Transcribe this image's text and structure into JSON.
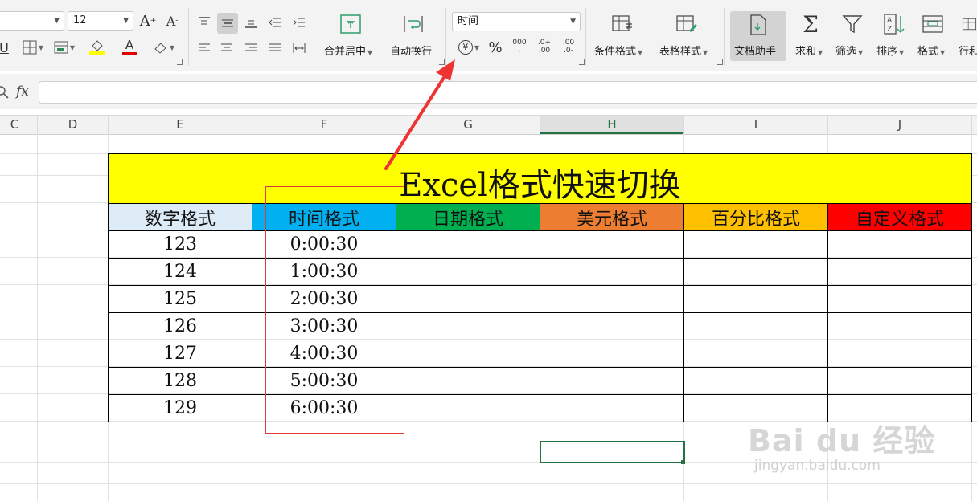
{
  "ribbon": {
    "font_size": "12",
    "align_merge": "合并居中",
    "wrap_text": "自动换行",
    "number_format": "时间",
    "yen_symbol": "¥",
    "percent_symbol": "%",
    "thousands_symbol": "000",
    "dec_inc": ".0+\n.00",
    "dec_dec": ".00\n.0-",
    "conditional_format": "条件格式",
    "table_style": "表格样式",
    "doc_assistant": "文档助手",
    "sum": "求和",
    "filter": "筛选",
    "sort": "排序",
    "format": "格式",
    "row_col": "行和"
  },
  "formula_bar": {
    "fx": "fx",
    "value": ""
  },
  "columns": [
    "C",
    "D",
    "E",
    "F",
    "G",
    "H",
    "I",
    "J"
  ],
  "sheet": {
    "title": "Excel格式快速切换",
    "headers": [
      "数字格式",
      "时间格式",
      "日期格式",
      "美元格式",
      "百分比格式",
      "自定义格式"
    ],
    "header_colors": [
      "#ddebf7",
      "#00b0f0",
      "#00b050",
      "#ed7d31",
      "#ffc000",
      "#ff0000"
    ],
    "title_bg": "#ffff00",
    "rows": [
      [
        "123",
        "0:00:30"
      ],
      [
        "124",
        "1:00:30"
      ],
      [
        "125",
        "2:00:30"
      ],
      [
        "126",
        "3:00:30"
      ],
      [
        "127",
        "4:00:30"
      ],
      [
        "128",
        "5:00:30"
      ],
      [
        "129",
        "6:00:30"
      ]
    ]
  },
  "watermark": {
    "brand": "Bai du 经验",
    "url": "jingyan.baidu.com"
  }
}
